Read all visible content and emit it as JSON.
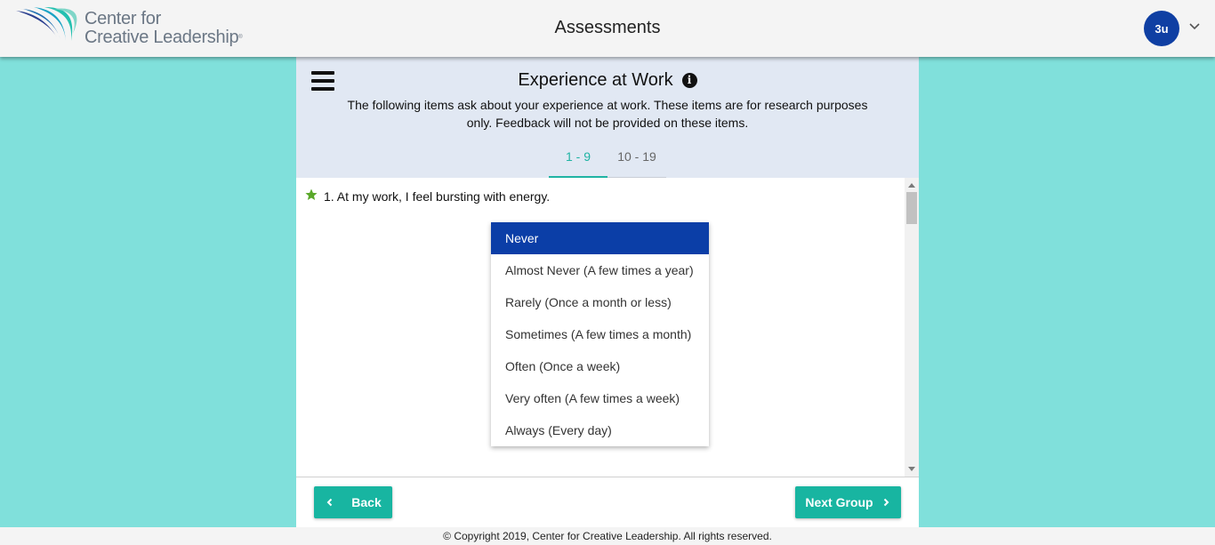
{
  "header": {
    "logo_line1": "Center for",
    "logo_line2": "Creative Leadership",
    "logo_mark": "®",
    "title": "Assessments",
    "user_initials": "3u",
    "user_menu_icon": "chevron-down-icon"
  },
  "section": {
    "title": "Experience at Work",
    "info_icon": "info-circle-icon",
    "info_glyph": "i",
    "description": "The following items ask about your experience at work. These items are for research purposes only. Feedback will not be provided on these items.",
    "tabs": [
      {
        "label": "1 - 9",
        "active": true
      },
      {
        "label": "10 - 19",
        "active": false
      }
    ]
  },
  "question": {
    "icon": "star-icon",
    "text": "1. At my work, I feel bursting with energy.",
    "options": [
      {
        "label": "Never",
        "selected": true
      },
      {
        "label": "Almost Never (A few times a year)",
        "selected": false
      },
      {
        "label": "Rarely (Once a month or less)",
        "selected": false
      },
      {
        "label": "Sometimes (A few times a month)",
        "selected": false
      },
      {
        "label": "Often (Once a week)",
        "selected": false
      },
      {
        "label": "Very often (A few times a week)",
        "selected": false
      },
      {
        "label": "Always (Every day)",
        "selected": false
      }
    ]
  },
  "navigation": {
    "back_label": "Back",
    "next_label": "Next Group"
  },
  "footer": {
    "copyright": "© Copyright 2019, Center for Creative Leadership. All rights reserved."
  },
  "colors": {
    "background": "#80e0db",
    "accent": "#18b5a1",
    "selected": "#0b3ea7",
    "avatar": "#0f3fa3"
  }
}
